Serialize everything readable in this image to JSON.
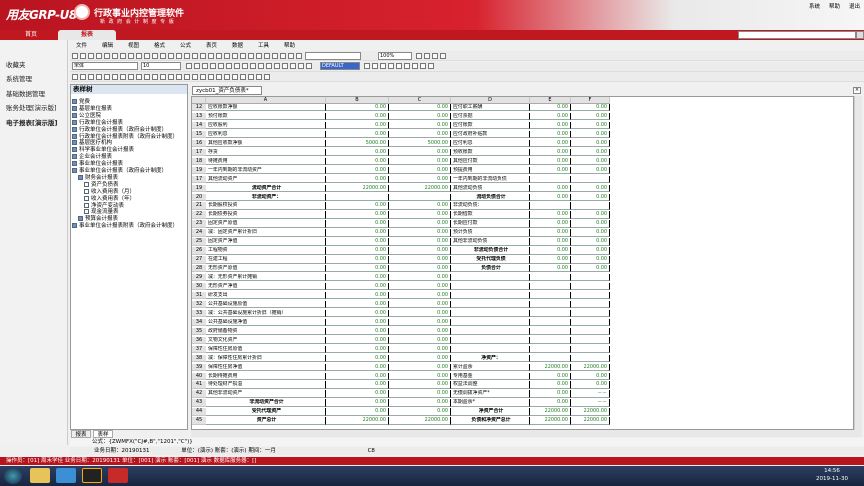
{
  "app": {
    "logo": "用友GRP-U8",
    "title": "行政事业内控管理软件",
    "subtitle": "新 政 府 会 计 制 度 专 版",
    "system_menu": [
      "系统",
      "帮助",
      "退出"
    ]
  },
  "top_tabs": [
    "首页",
    "报表"
  ],
  "left_nav": [
    "收藏夹",
    "系统管理",
    "基础数据管理",
    "账务处理[演示版]",
    "电子报表[演示版]"
  ],
  "menubar": [
    "文件",
    "编辑",
    "视图",
    "格式",
    "公式",
    "表页",
    "数据",
    "工具",
    "帮助"
  ],
  "toolbar": {
    "font_name": "宋体",
    "font_size": "10",
    "zoom": "100%",
    "color_box": "DEFAULT"
  },
  "tree": {
    "title": "表样树",
    "nodes": [
      {
        "label": "党费",
        "indent": 0
      },
      {
        "label": "基层单位报表",
        "indent": 0
      },
      {
        "label": "公立医院",
        "indent": 0
      },
      {
        "label": "行政单位会计报表",
        "indent": 0
      },
      {
        "label": "行政单位会计报表（政府会计制度）",
        "indent": 0
      },
      {
        "label": "行政单位会计报表附表（政府会计制度）",
        "indent": 0
      },
      {
        "label": "基层医疗机构",
        "indent": 0
      },
      {
        "label": "科学事业单位会计报表",
        "indent": 0
      },
      {
        "label": "企业会计报表",
        "indent": 0
      },
      {
        "label": "事业单位会计报表",
        "indent": 0
      },
      {
        "label": "事业单位会计报表（政府会计制度）",
        "indent": 0
      },
      {
        "label": "财务会计报表",
        "indent": 1
      },
      {
        "label": "资产负债表",
        "indent": 2
      },
      {
        "label": "收入费用表（月）",
        "indent": 2
      },
      {
        "label": "收入费用表（年）",
        "indent": 2
      },
      {
        "label": "净资产变动表",
        "indent": 2
      },
      {
        "label": "现金流量表",
        "indent": 2
      },
      {
        "label": "预算会计报表",
        "indent": 1
      },
      {
        "label": "事业单位会计报表附表（政府会计制度）",
        "indent": 0
      }
    ],
    "tabs": [
      "报表",
      "表样"
    ]
  },
  "document_tab": "zycb01_资产负债表*",
  "sheet": {
    "columns": [
      "A",
      "B",
      "C",
      "D",
      "E",
      "F"
    ],
    "rows": [
      {
        "n": "12",
        "A": "应收账款净额",
        "B": "0.00",
        "C": "0.00",
        "D": "应付职工薪酬",
        "E": "0.00",
        "F": "0.00"
      },
      {
        "n": "13",
        "A": "预付账款",
        "B": "0.00",
        "C": "0.00",
        "D": "应付票据",
        "E": "0.00",
        "F": "0.00"
      },
      {
        "n": "14",
        "A": "应收股利",
        "B": "0.00",
        "C": "0.00",
        "D": "应付账款",
        "E": "0.00",
        "F": "0.00"
      },
      {
        "n": "15",
        "A": "应收利息",
        "B": "0.00",
        "C": "0.00",
        "D": "应付政府补贴款",
        "E": "0.00",
        "F": "0.00"
      },
      {
        "n": "16",
        "A": "其他应收款净额",
        "B": "5000.00",
        "C": "5000.00",
        "D": "应付利息",
        "E": "0.00",
        "F": "0.00"
      },
      {
        "n": "17",
        "A": "存货",
        "B": "0.00",
        "C": "0.00",
        "D": "预收账款",
        "E": "0.00",
        "F": "0.00"
      },
      {
        "n": "18",
        "A": "待摊费用",
        "B": "0.00",
        "C": "0.00",
        "D": "其他应付款",
        "E": "0.00",
        "F": "0.00"
      },
      {
        "n": "19",
        "A": "一年内到期的非流动资产",
        "B": "0.00",
        "C": "0.00",
        "D": "预提费用",
        "E": "0.00",
        "F": "0.00"
      },
      {
        "n": "17",
        "A": "其他流动资产",
        "B": "0.00",
        "C": "0.00",
        "D": "一年内到期的非流动负债",
        "E": "",
        "F": ""
      },
      {
        "n": "19",
        "A": "流动资产合计",
        "B": "22000.00",
        "C": "22000.00",
        "D": "其他流动负债",
        "E": "0.00",
        "F": "0.00",
        "Ab": true
      },
      {
        "n": "20",
        "A": "非流动资产：",
        "B": "",
        "C": "",
        "D": "流动负债合计",
        "E": "0.00",
        "F": "0.00",
        "Ab": true,
        "Db": true
      },
      {
        "n": "21",
        "A": "长期股权投资",
        "B": "0.00",
        "C": "0.00",
        "D": "非流动负债：",
        "E": "",
        "F": ""
      },
      {
        "n": "22",
        "A": "长期债券投资",
        "B": "0.00",
        "C": "0.00",
        "D": "长期借款",
        "E": "0.00",
        "F": "0.00"
      },
      {
        "n": "23",
        "A": "固定资产原值",
        "B": "0.00",
        "C": "0.00",
        "D": "长期应付款",
        "E": "0.00",
        "F": "0.00"
      },
      {
        "n": "24",
        "A": "减：固定资产累计折旧",
        "B": "0.00",
        "C": "0.00",
        "D": "预计负债",
        "E": "0.00",
        "F": "0.00"
      },
      {
        "n": "25",
        "A": "固定资产净值",
        "B": "0.00",
        "C": "0.00",
        "D": "其他非流动负债",
        "E": "0.00",
        "F": "0.00"
      },
      {
        "n": "26",
        "A": "工程物资",
        "B": "0.00",
        "C": "0.00",
        "D": "非流动负债合计",
        "E": "0.00",
        "F": "0.00",
        "Db": true
      },
      {
        "n": "27",
        "A": "在建工程",
        "B": "0.00",
        "C": "0.00",
        "D": "受托代理负债",
        "E": "0.00",
        "F": "0.00",
        "Db": true
      },
      {
        "n": "28",
        "A": "无形资产原值",
        "B": "0.00",
        "C": "0.00",
        "D": "负债合计",
        "E": "0.00",
        "F": "0.00",
        "Db": true
      },
      {
        "n": "29",
        "A": "减：无形资产累计摊销",
        "B": "0.00",
        "C": "0.00",
        "D": "",
        "E": "",
        "F": ""
      },
      {
        "n": "30",
        "A": "无形资产净值",
        "B": "0.00",
        "C": "0.00",
        "D": "",
        "E": "",
        "F": ""
      },
      {
        "n": "31",
        "A": "研发支出",
        "B": "0.00",
        "C": "0.00",
        "D": "",
        "E": "",
        "F": ""
      },
      {
        "n": "32",
        "A": "公共基础设施原值",
        "B": "0.00",
        "C": "0.00",
        "D": "",
        "E": "",
        "F": ""
      },
      {
        "n": "33",
        "A": "减：公共基础设施累计折旧（摊销）",
        "B": "0.00",
        "C": "0.00",
        "D": "",
        "E": "",
        "F": ""
      },
      {
        "n": "34",
        "A": "公共基础设施净值",
        "B": "0.00",
        "C": "0.00",
        "D": "",
        "E": "",
        "F": ""
      },
      {
        "n": "35",
        "A": "政府储备物资",
        "B": "0.00",
        "C": "0.00",
        "D": "",
        "E": "",
        "F": ""
      },
      {
        "n": "36",
        "A": "文物文化资产",
        "B": "0.00",
        "C": "0.00",
        "D": "",
        "E": "",
        "F": ""
      },
      {
        "n": "37",
        "A": "保障性住房原值",
        "B": "0.00",
        "C": "0.00",
        "D": "",
        "E": "",
        "F": ""
      },
      {
        "n": "38",
        "A": "减：保障性住房累计折旧",
        "B": "0.00",
        "C": "0.00",
        "D": "净资产：",
        "E": "",
        "F": "",
        "Db": true
      },
      {
        "n": "39",
        "A": "保障性住房净值",
        "B": "0.00",
        "C": "0.00",
        "D": "累计盈余",
        "E": "22000.00",
        "F": "22000.00"
      },
      {
        "n": "40",
        "A": "长期待摊费用",
        "B": "0.00",
        "C": "0.00",
        "D": "专用基金",
        "E": "0.00",
        "F": "0.00"
      },
      {
        "n": "41",
        "A": "待处理财产损溢",
        "B": "0.00",
        "C": "0.00",
        "D": "权益法调整",
        "E": "0.00",
        "F": "0.00"
      },
      {
        "n": "42",
        "A": "其他非流动资产",
        "B": "0.00",
        "C": "0.00",
        "D": "无偿调拨净资产*",
        "E": "0.00",
        "F": "－－"
      },
      {
        "n": "43",
        "A": "非流动资产合计",
        "B": "0.00",
        "C": "0.00",
        "D": "本期盈余*",
        "E": "0.00",
        "F": "－－",
        "Ab": true
      },
      {
        "n": "44",
        "A": "受托代理资产",
        "B": "0.00",
        "C": "0.00",
        "D": "净资产合计",
        "E": "22000.00",
        "F": "22000.00",
        "Ab": true,
        "Db": true
      },
      {
        "n": "45",
        "A": "资产总计",
        "B": "22000.00",
        "C": "22000.00",
        "D": "负债和净资产总计",
        "E": "22000.00",
        "F": "22000.00",
        "Ab": true,
        "Db": true
      }
    ]
  },
  "formula_bar": "公式：{ZWMFX(\"CJ#,B\",\"1201\",\"C\")}",
  "status_row": {
    "date_label": "业务日期：20190131",
    "mode": "单位：(演示) 账套：(演示) 期间：一月",
    "cell": "C8"
  },
  "status_bar": "操作员：[01] 周禾学佳    业务日期：20190131    单位：[001] 演示    账套：[001] 演示    数据库服务器：[]",
  "clock": {
    "time": "14:56",
    "date": "2019-11-30"
  }
}
